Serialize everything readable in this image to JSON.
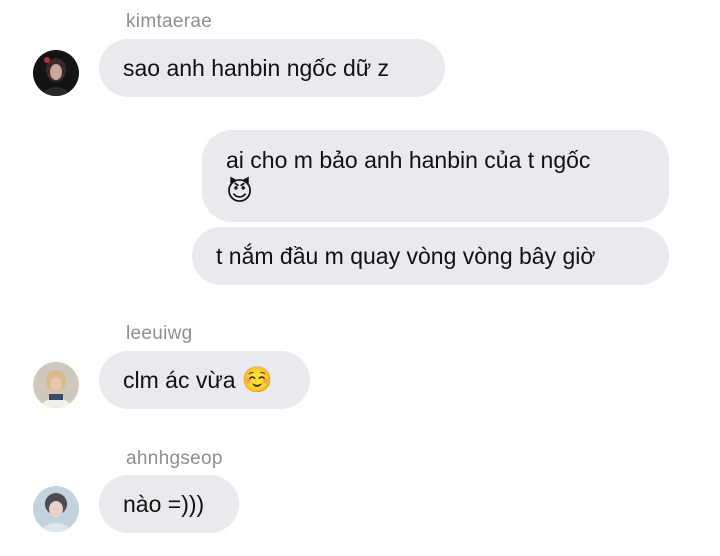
{
  "messages": [
    {
      "sender": "kimtaerae",
      "text": "sao anh hanbin ngốc dữ z",
      "direction": "incoming"
    },
    {
      "direction": "outgoing",
      "text": "ai cho m bảo anh hanbin của t ngốc",
      "emoji": "😈"
    },
    {
      "direction": "outgoing",
      "text": "t nắm đầu m quay vòng vòng bây giờ"
    },
    {
      "sender": "leeuiwg",
      "text": "clm ác vừa",
      "emoji": "☺️",
      "direction": "incoming"
    },
    {
      "sender": "ahnhgseop",
      "text": "nào =)))",
      "direction": "incoming"
    }
  ],
  "colors": {
    "bubble": "#e9e9ee",
    "sender_name": "#8e8e93",
    "text": "#111111"
  }
}
